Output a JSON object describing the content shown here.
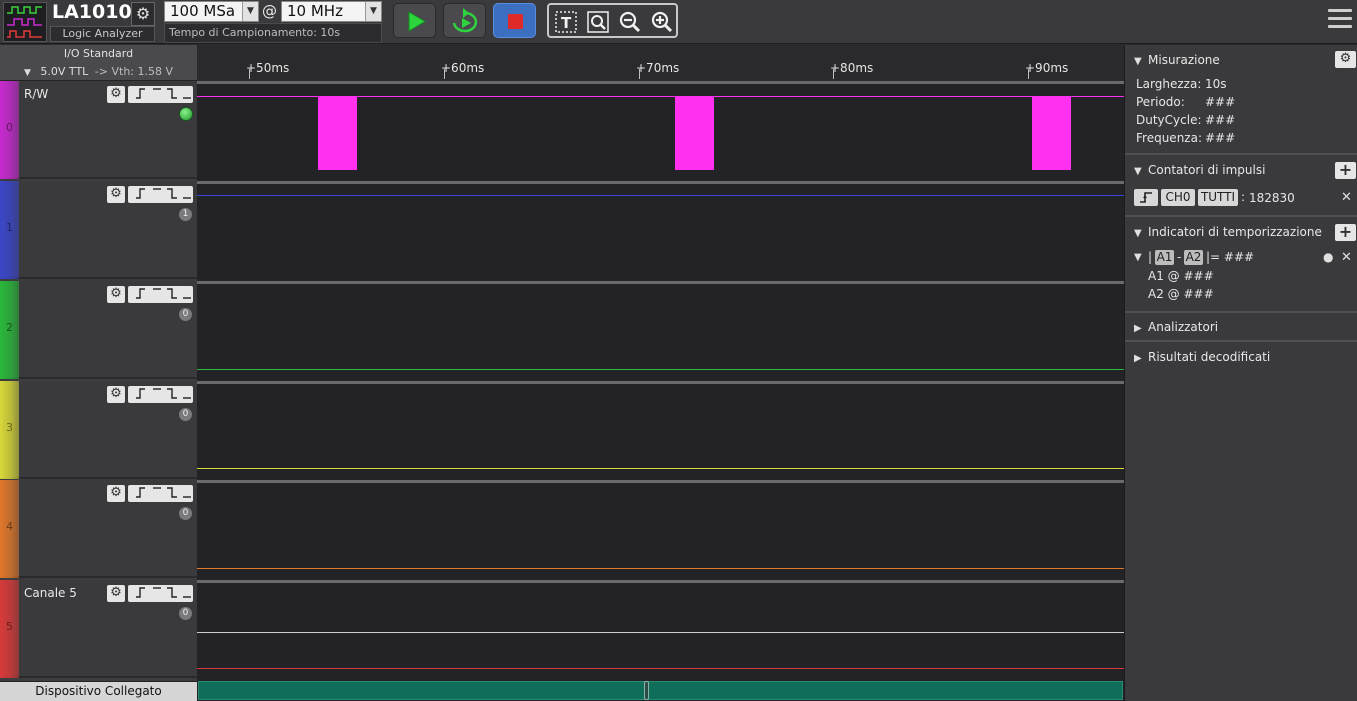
{
  "app": {
    "name": "LA1010",
    "subtitle": "Logic Analyzer"
  },
  "toolbar": {
    "sample_count": "100 MSa",
    "at_sign": "@",
    "sample_rate": "10 MHz",
    "sample_time": "Tempo di Campionamento: 10s"
  },
  "io": {
    "title": "I/O Standard",
    "standard": "5.0V TTL",
    "vth": "-> Vth:  1.58 V"
  },
  "channels": [
    {
      "index": "0",
      "name": "R/W",
      "color": "#c82ad0",
      "badge": ""
    },
    {
      "index": "1",
      "name": "",
      "color": "#3a46c8",
      "badge": "1"
    },
    {
      "index": "2",
      "name": "",
      "color": "#2ab83a",
      "badge": "0"
    },
    {
      "index": "3",
      "name": "",
      "color": "#d8d83a",
      "badge": "0"
    },
    {
      "index": "4",
      "name": "",
      "color": "#e0782a",
      "badge": "0"
    },
    {
      "index": "5",
      "name": "Canale 5",
      "color": "#d83a3a",
      "badge": "0"
    }
  ],
  "device": {
    "status": "Dispositivo Collegato"
  },
  "time_axis": {
    "labels": [
      "+50ms",
      "+60ms",
      "+70ms",
      "+80ms",
      "+90ms"
    ]
  },
  "pulse_color": "#ff30f0",
  "measure": {
    "title": "Misurazione",
    "rows": [
      {
        "label": "Larghezza:",
        "value": "10s"
      },
      {
        "label": "Periodo:",
        "value": "###"
      },
      {
        "label": "DutyCycle:",
        "value": "###"
      },
      {
        "label": "Frequenza:",
        "value": "###"
      }
    ]
  },
  "counters": {
    "title": "Contatori di impulsi",
    "channel": "CH0",
    "scope": "TUTTI",
    "separator": ":",
    "count": "182830"
  },
  "timing": {
    "title": "Indicatori di temporizzazione",
    "a1": "A1",
    "a2": "A2",
    "dash": "-",
    "result": "|= ###",
    "a1_at": "A1 @ ###",
    "a2_at": "A2 @ ###"
  },
  "analyzers": {
    "title": "Analizzatori"
  },
  "decoded": {
    "title": "Risultati decodificati"
  }
}
